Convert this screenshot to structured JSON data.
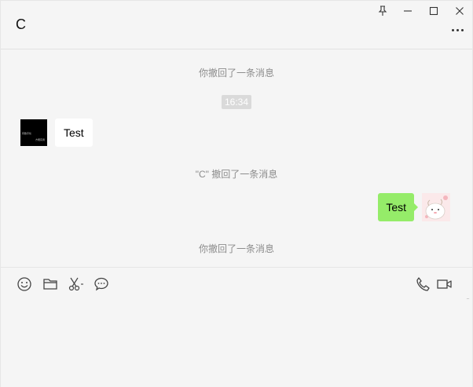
{
  "window": {
    "title": "C",
    "controls": [
      "pin-icon",
      "minimize-icon",
      "maximize-icon",
      "close-icon"
    ],
    "more_icon": "more-icon"
  },
  "messages": [
    {
      "type": "system",
      "text": "你撤回了一条消息"
    },
    {
      "type": "time",
      "text": "16:34"
    },
    {
      "type": "incoming",
      "text": "Test",
      "avatar_text": [
        "有数字化",
        "方便实用"
      ]
    },
    {
      "type": "system",
      "text": "\"C\" 撤回了一条消息"
    },
    {
      "type": "outgoing",
      "text": "Test"
    },
    {
      "type": "system",
      "text": "你撤回了一条消息"
    }
  ],
  "toolbar": {
    "left": [
      "emoji-icon",
      "folder-icon",
      "scissors-icon",
      "chat-bubble-icon"
    ],
    "right": [
      "phone-icon",
      "video-icon"
    ]
  },
  "colors": {
    "background": "#f5f5f5",
    "outgoing_bubble": "#95ec69",
    "incoming_bubble": "#ffffff",
    "system_text": "#8c8c8c",
    "time_chip": "#dadada"
  }
}
